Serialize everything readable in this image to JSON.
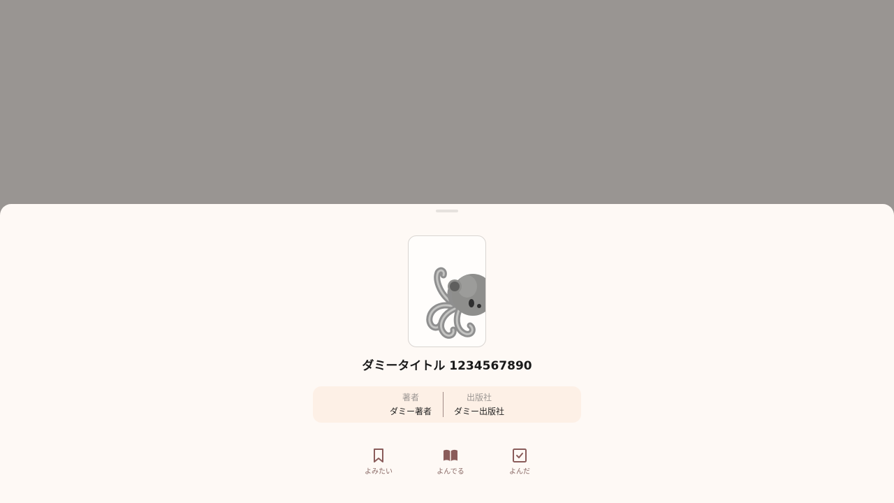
{
  "book": {
    "cover_icon": "octopus-icon",
    "title": "ダミータイトル 1234567890"
  },
  "meta": {
    "author_label": "著者",
    "author_value": "ダミー著者",
    "publisher_label": "出版社",
    "publisher_value": "ダミー出版社"
  },
  "actions": {
    "want_to_read": {
      "label": "よみたい",
      "icon": "bookmark-icon"
    },
    "reading": {
      "label": "よんでる",
      "icon": "open-book-icon"
    },
    "read": {
      "label": "よんだ",
      "icon": "checkbox-icon"
    }
  },
  "colors": {
    "backdrop": "#999592",
    "sheet": "#fef9f5",
    "meta_bg": "#fdf0e6",
    "accent": "#8a5c5a"
  }
}
